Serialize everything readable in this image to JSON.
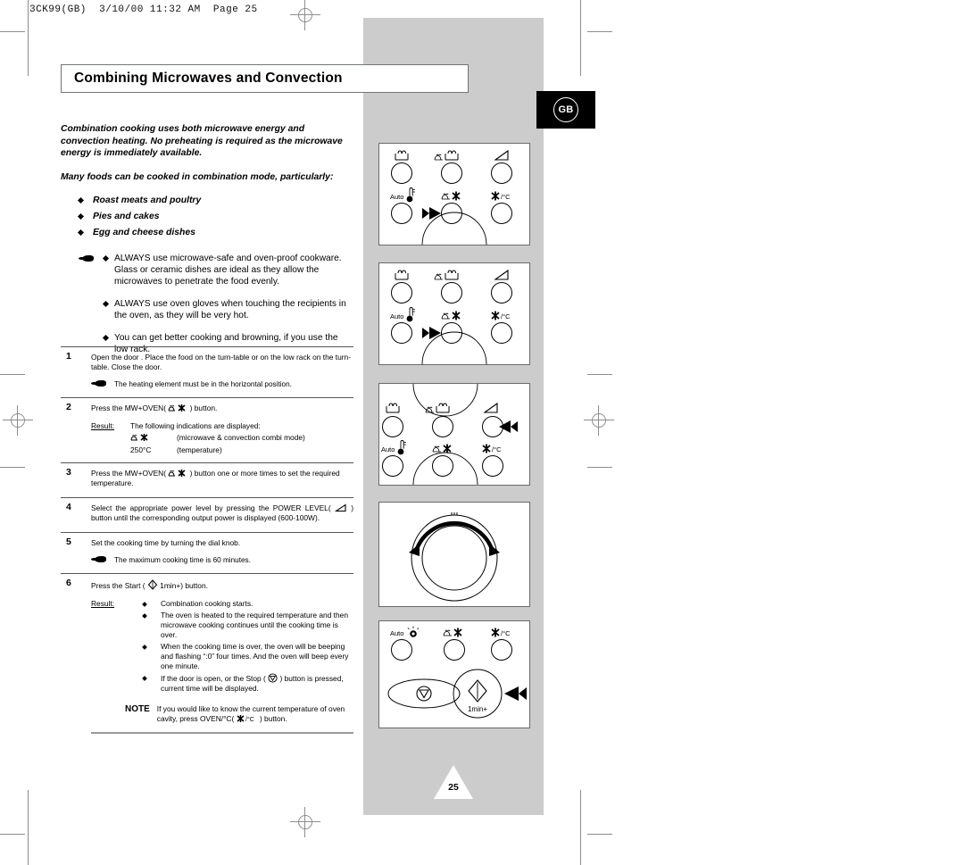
{
  "print_header": "3CK99(GB)  3/10/00 11:32 AM  Page 25",
  "locale_badge": "GB",
  "page_number": "25",
  "title": "Combining Microwaves and Convection",
  "intro": {
    "paragraph1": "Combination cooking uses both microwave energy and convection heating. No preheating is required as the microwave energy is immediately available.",
    "paragraph2": "Many foods can be cooked in combination mode, particularly:",
    "food_items": [
      "Roast meats and poultry",
      "Pies and cakes",
      "Egg and cheese dishes"
    ]
  },
  "always_notes": [
    "ALWAYS use microwave-safe and oven-proof cookware. Glass or ceramic dishes are ideal as they allow the microwaves to penetrate the food evenly.",
    "ALWAYS use oven gloves when touching the recipients in the oven, as they will be very hot.",
    "You can get better cooking and browning, if you use the low rack."
  ],
  "steps": [
    {
      "number": "1",
      "text": "Open the door . Place the food on the turn-table or on the low rack on the turn-table. Close the door.",
      "tip": "The heating element must be in the horizontal position."
    },
    {
      "number": "2",
      "text_before": "Press the MW+OVEN(",
      "text_after": ") button.",
      "result_label": "Result:",
      "result_intro": "The following indications are displayed:",
      "result_rows": [
        {
          "key_icon": "mw-convection-combi-icon",
          "value": "(microwave & convection combi mode)"
        },
        {
          "key": "250°C",
          "value": "(temperature)"
        }
      ]
    },
    {
      "number": "3",
      "text_before": "Press the MW+OVEN(",
      "text_after": ") button one or more times to set the required temperature."
    },
    {
      "number": "4",
      "text_before": "Select the appropriate power level by pressing the POWER LEVEL(",
      "text_after": ") button until the corresponding output power  is displayed (600-100W)."
    },
    {
      "number": "5",
      "text": "Set the cooking time by turning the dial knob.",
      "tip": "The maximum cooking time is 60 minutes."
    },
    {
      "number": "6",
      "text_before": "Press the Start (",
      "text_after": "1min+) button.",
      "result_label": "Result:",
      "result_bullets": [
        "Combination cooking starts.",
        "The oven is heated to the required temperature and then microwave cooking continues until the cooking time is over.",
        "When the cooking time is over, the oven will be beeping and flashing “:0” four times. And the oven will beep every one minute."
      ],
      "result_bullet_stop_before": "If the door is open, or the Stop (",
      "result_bullet_stop_after": ") button is pressed, current time will be displayed."
    }
  ],
  "note": {
    "label": "NOTE",
    "text_before": "If you would like to know the current temperature of oven cavity, press OVEN/°C(",
    "text_after": ") button."
  },
  "control_panel": {
    "row1_labels": [
      "oven-icon",
      "mw-oven-icon",
      "power-level-icon"
    ],
    "row2_labels": [
      "Auto",
      "mw-convection-combi-icon",
      "oven-celsius-icon"
    ],
    "auto_label": "Auto",
    "oven_celsius_label": "/°C",
    "start_label": "1min+"
  },
  "panels": [
    {
      "name": "panel-step2-mw-oven-button",
      "highlight": "mw-oven-combi-button",
      "arrow": "right"
    },
    {
      "name": "panel-step3-mw-oven-button",
      "highlight": "mw-oven-combi-button",
      "arrow": "right"
    },
    {
      "name": "panel-step4-power-level-button",
      "highlight": "power-level-button",
      "arrow": "left"
    },
    {
      "name": "panel-step5-dial-knob",
      "highlight": "dial-knob",
      "arrow": "rotate"
    },
    {
      "name": "panel-step6-start-button",
      "highlight": "start-button",
      "arrow": "left"
    }
  ],
  "colors": {
    "gray_column": "#cccccc",
    "badge_bg": "#000000",
    "rule": "#555555"
  }
}
